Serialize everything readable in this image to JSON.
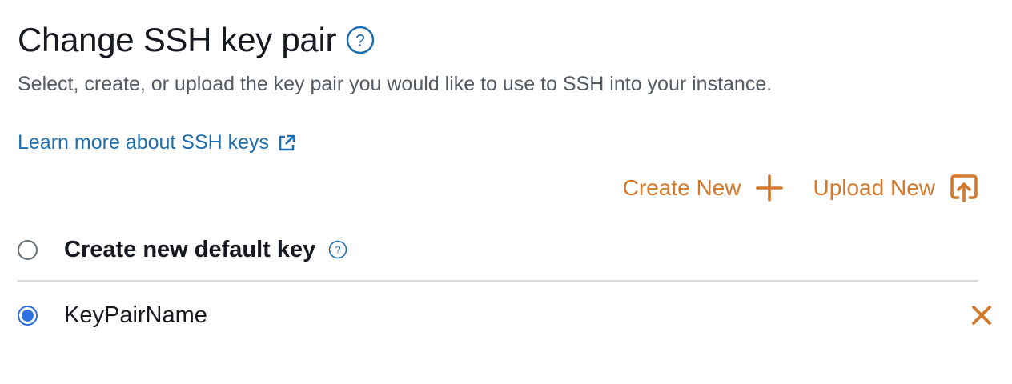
{
  "header": {
    "title": "Change SSH key pair",
    "help_icon": "question-circle-icon"
  },
  "description": "Select, create, or upload the key pair you would like to use to SSH into your instance.",
  "learn_more": {
    "label": "Learn more about SSH keys",
    "icon": "external-link-icon"
  },
  "actions": {
    "create_new_label": "Create New",
    "create_new_icon": "plus-icon",
    "upload_new_label": "Upload New",
    "upload_new_icon": "upload-icon"
  },
  "options": [
    {
      "label": "Create new default key",
      "selected": false,
      "help_icon": "question-circle-icon"
    },
    {
      "label": "KeyPairName",
      "selected": true,
      "remove_icon": "close-icon"
    }
  ],
  "colors": {
    "accent_orange": "#d4782c",
    "link_blue": "#1f6fae",
    "radio_blue": "#2f6fe0",
    "text_primary": "#16191f",
    "text_secondary": "#545b64"
  }
}
